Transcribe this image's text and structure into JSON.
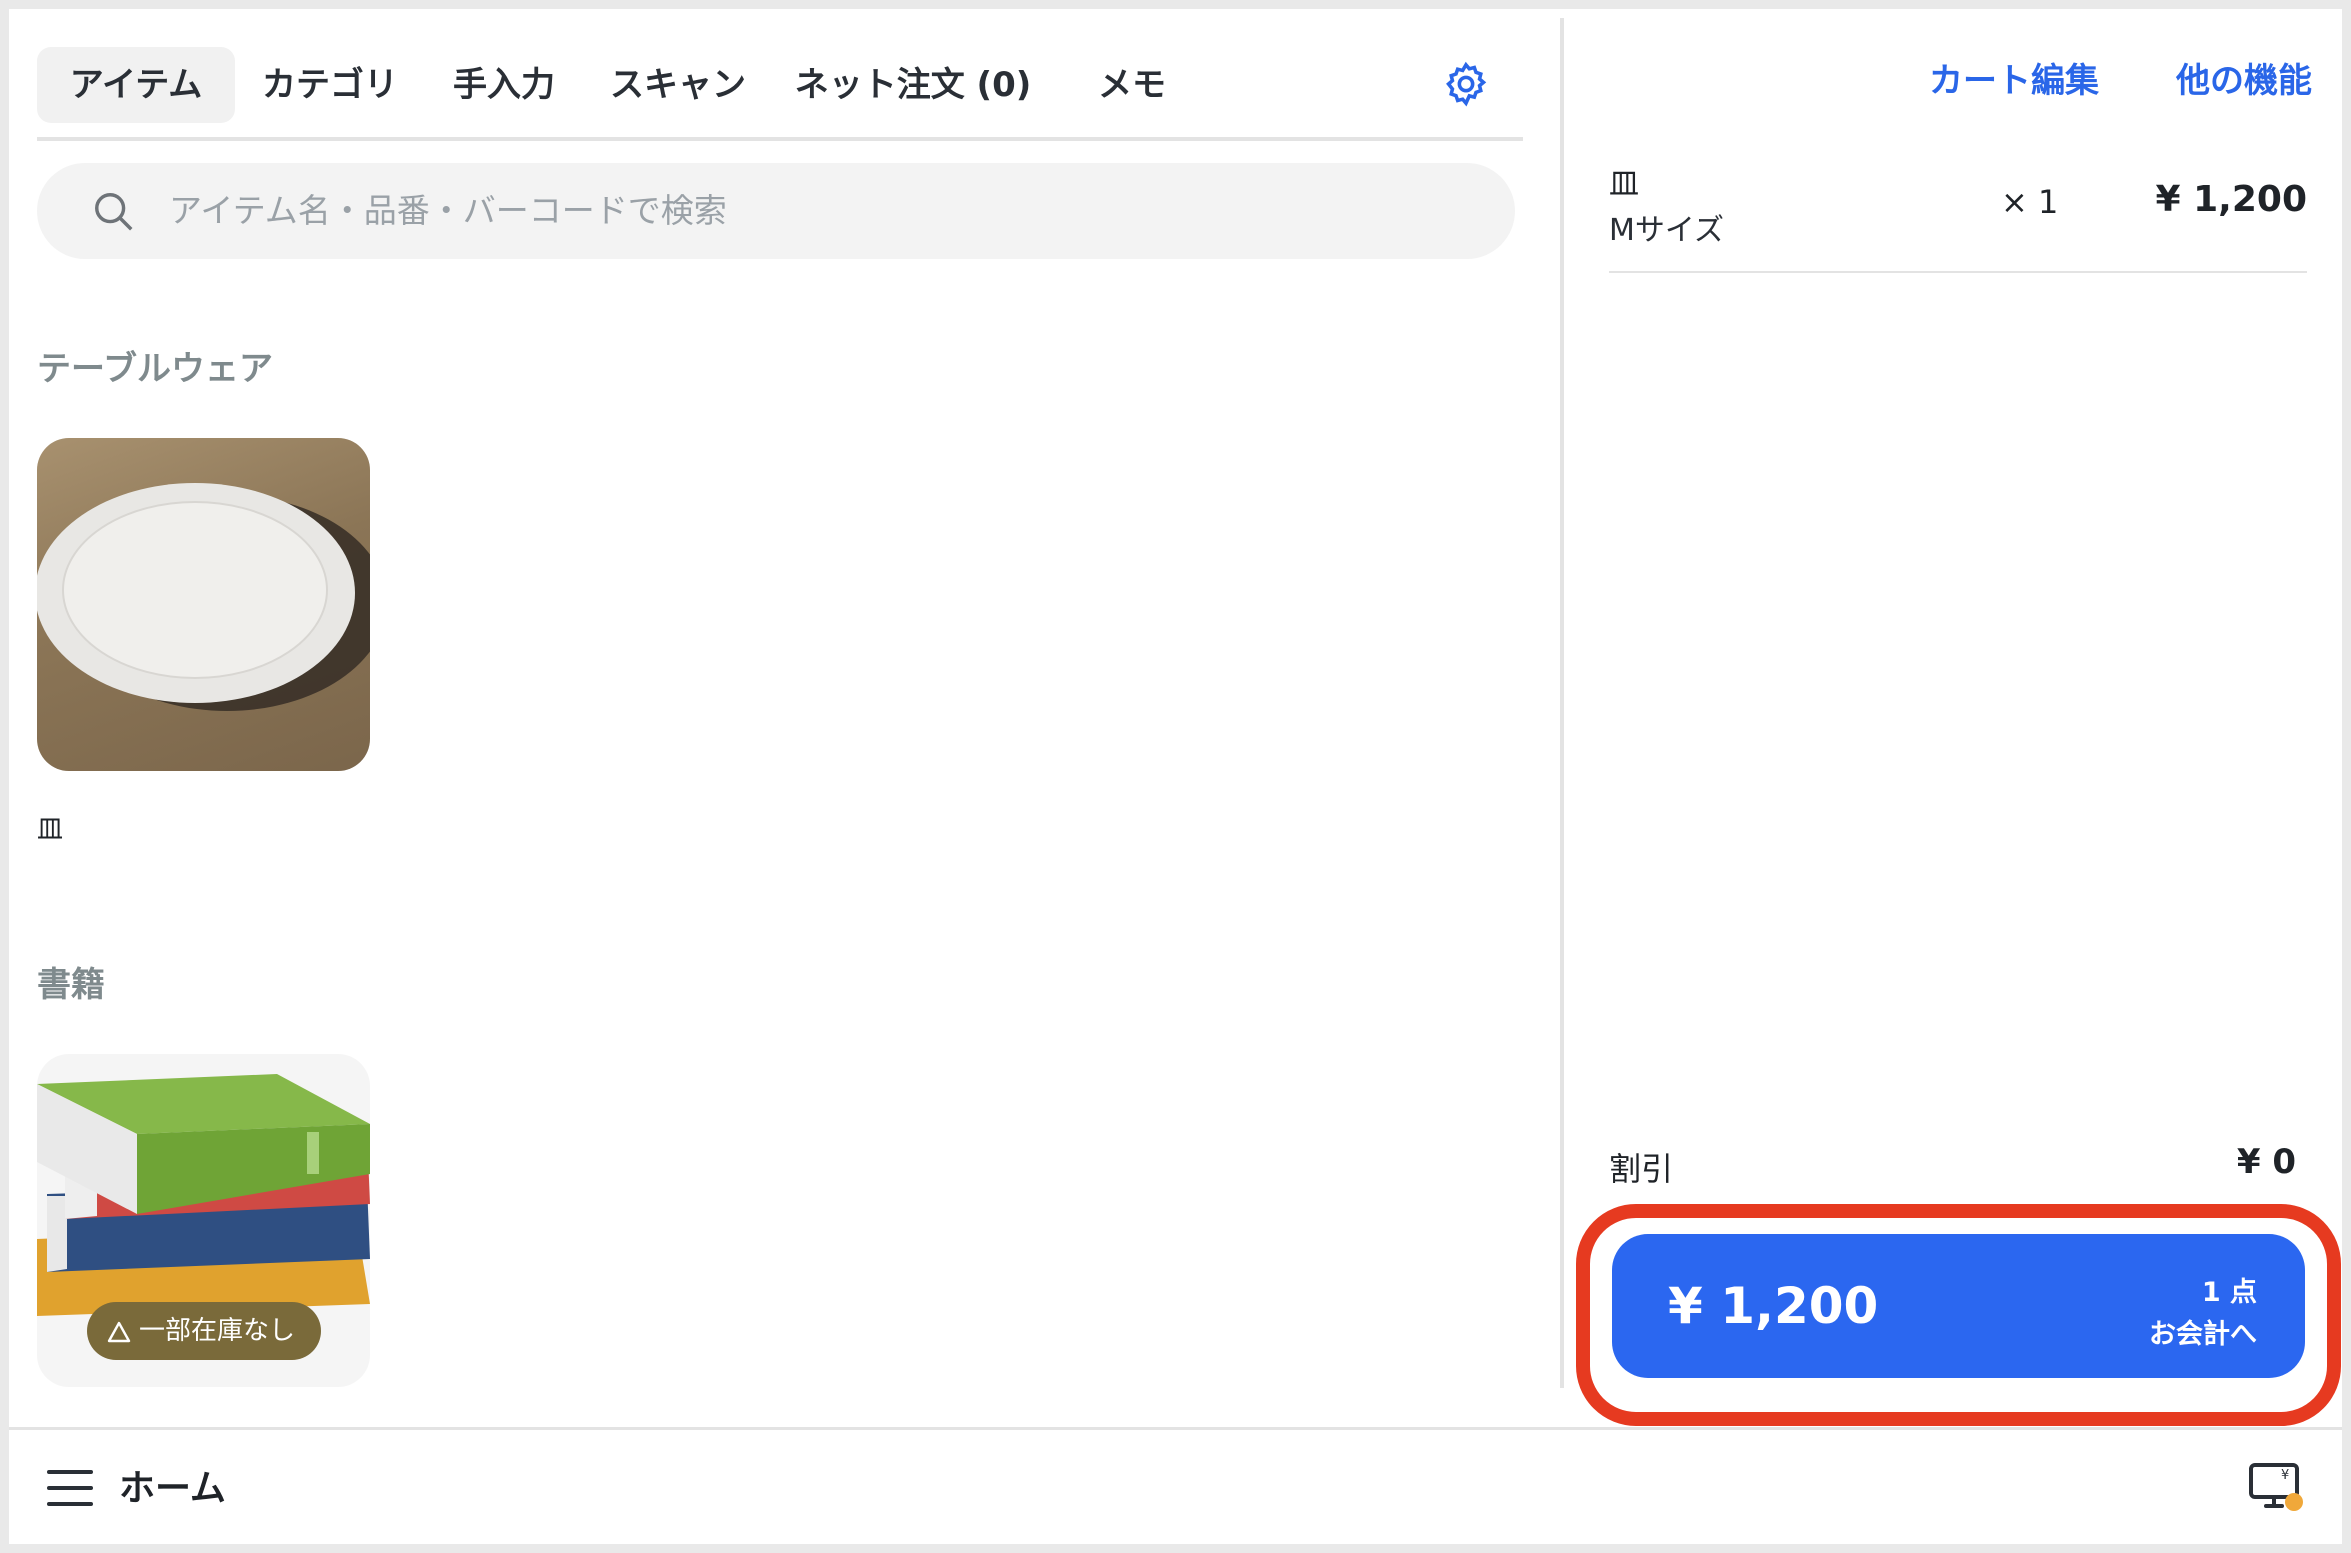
{
  "tabs": [
    {
      "label": "アイテム"
    },
    {
      "label": "カテゴリ"
    },
    {
      "label": "手入力"
    },
    {
      "label": "スキャン"
    },
    {
      "label": "ネット注文 (0)"
    },
    {
      "label": "メモ"
    }
  ],
  "search": {
    "placeholder": "アイテム名・品番・バーコードで検索"
  },
  "sections": [
    {
      "title": "テーブルウェア",
      "items": [
        {
          "name": "皿"
        }
      ]
    },
    {
      "title": "書籍",
      "items": [
        {
          "name": "",
          "badge": "一部在庫なし"
        }
      ]
    }
  ],
  "cart_header": {
    "edit": "カート編集",
    "more": "他の機能"
  },
  "cart": [
    {
      "name": "皿",
      "variant": "Mサイズ",
      "qty": "× 1",
      "price": "¥ 1,200"
    }
  ],
  "discount": {
    "label": "割引",
    "value": "¥ 0"
  },
  "checkout": {
    "total": "¥ 1,200",
    "count": "1 点",
    "label": "お会計へ"
  },
  "bottom": {
    "home": "ホーム"
  },
  "colors": {
    "accent": "#2b67f0",
    "highlight": "#e63a20",
    "badge": "#7a6a3a"
  },
  "icons": [
    "gear-icon",
    "search-icon",
    "warning-triangle-icon",
    "menu-icon",
    "register-display-icon"
  ]
}
